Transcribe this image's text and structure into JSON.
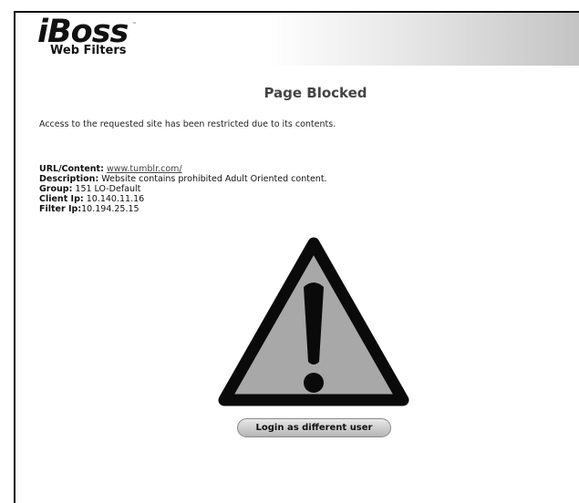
{
  "logo": {
    "brand": "iBoss",
    "tagline": "Web Filters"
  },
  "page": {
    "title": "Page Blocked",
    "intro": "Access to the requested site has been restricted due to its contents."
  },
  "details": {
    "url_label": "URL/Content:",
    "url_value": "www.tumblr.com/",
    "description_label": "Description:",
    "description_value": "Website contains prohibited Adult Oriented content.",
    "group_label": "Group:",
    "group_value": "151 LO-Default",
    "client_ip_label": "Client Ip:",
    "client_ip_value": "10.140.11.16",
    "filter_ip_label": "Filter Ip:",
    "filter_ip_value": "10.194.25.15"
  },
  "actions": {
    "login_label": "Login as different user"
  },
  "icons": {
    "warning": "warning-triangle-icon"
  },
  "colors": {
    "triangle_fill": "#a8a8a8",
    "triangle_stroke": "#0a0a0a",
    "header_gradient_end": "#c4c4c4"
  }
}
